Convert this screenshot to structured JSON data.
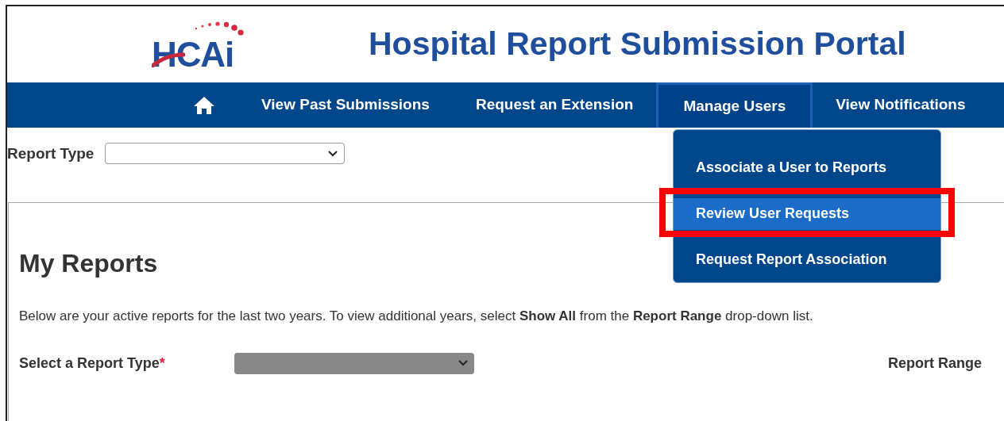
{
  "header": {
    "logo": "HCAi",
    "title": "Hospital Report Submission Portal"
  },
  "nav": {
    "items": [
      {
        "kind": "home",
        "selected": false
      },
      {
        "kind": "link",
        "label": "View Past Submissions",
        "selected": false
      },
      {
        "kind": "link",
        "label": "Request an Extension",
        "selected": false
      },
      {
        "kind": "link",
        "label": "Manage Users",
        "selected": true
      },
      {
        "kind": "link",
        "label": "View Notifications",
        "selected": false
      }
    ]
  },
  "dropdown_menu": {
    "items": [
      {
        "label": "Associate a User to Reports",
        "selected": false,
        "outlined": false
      },
      {
        "label": "Review User Requests",
        "selected": true,
        "outlined": true
      },
      {
        "label": "Request Report Association",
        "selected": false,
        "outlined": false
      }
    ]
  },
  "report_type": {
    "label": "Report Type",
    "disabled": false
  },
  "my_reports": {
    "title": "My Reports",
    "description": "Below are your active reports for the last two years. To view additional years, select **Show All** from the **Report Range** drop-down list.",
    "report_type_select": {
      "label": "Select a Report Type",
      "required_mark": "*",
      "disabled": true
    },
    "report_range_label": "Report Range"
  }
}
